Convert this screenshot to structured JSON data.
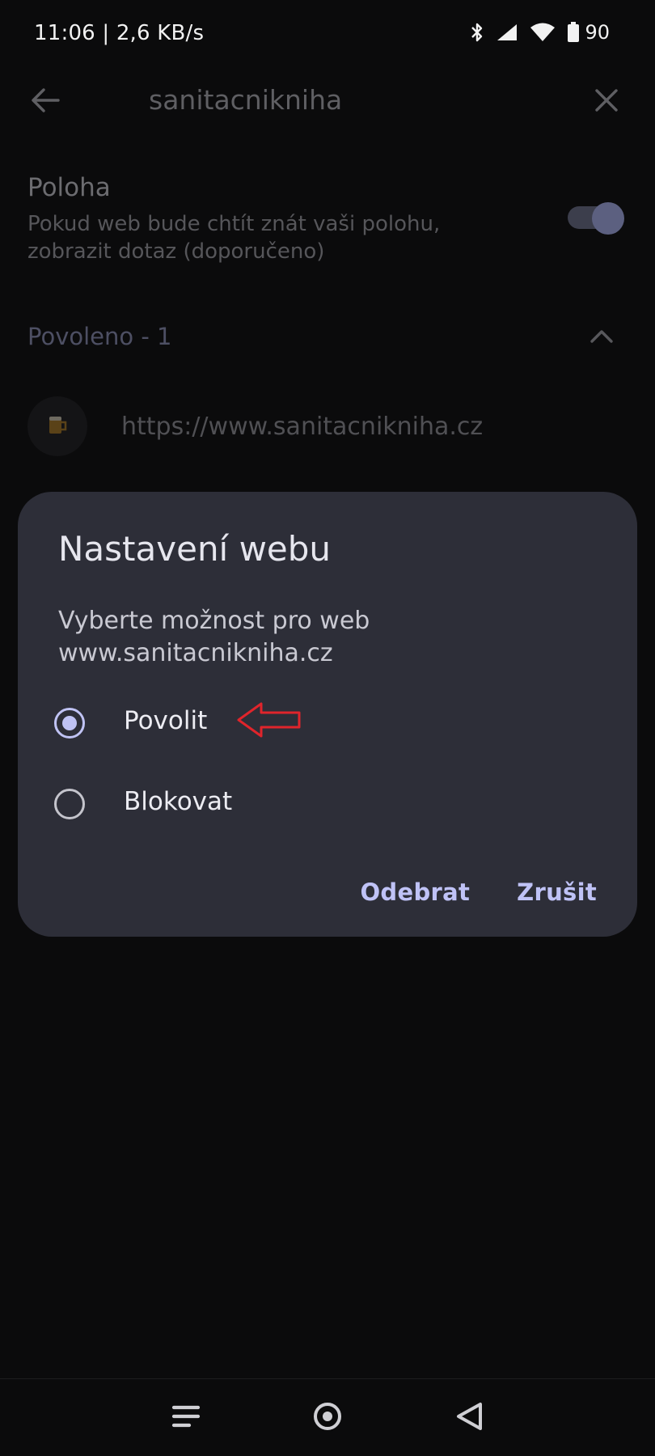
{
  "status_bar": {
    "time_speed": "11:06 | 2,6 KB/s",
    "battery": "90",
    "icons": [
      "bluetooth-icon",
      "signal-icon",
      "wifi-icon",
      "battery-icon"
    ]
  },
  "app_bar": {
    "title": "sanitacnikniha",
    "back_icon": "arrow-left-icon",
    "close_icon": "close-icon"
  },
  "setting": {
    "title": "Poloha",
    "description": "Pokud web bude chtít znát vaši polohu, zobrazit dotaz (doporučeno)",
    "toggle_on": true
  },
  "section": {
    "title": "Povoleno - 1",
    "expand_icon": "chevron-up-icon"
  },
  "site_item": {
    "url": "https://www.sanitacnikniha.cz",
    "favicon": "beer-mug-icon"
  },
  "dialog": {
    "title": "Nastavení webu",
    "message": "Vyberte možnost pro web www.sanitacnikniha.cz",
    "options": [
      {
        "label": "Povolit",
        "selected": true
      },
      {
        "label": "Blokovat",
        "selected": false
      }
    ],
    "remove_label": "Odebrat",
    "cancel_label": "Zrušit"
  },
  "colors": {
    "accent": "#c0c3f4",
    "dialog_bg": "#2d2e38",
    "annotation": "#e0242b"
  },
  "nav_bar": {
    "icons": [
      "recents-icon",
      "home-icon",
      "back-triangle-icon"
    ]
  }
}
